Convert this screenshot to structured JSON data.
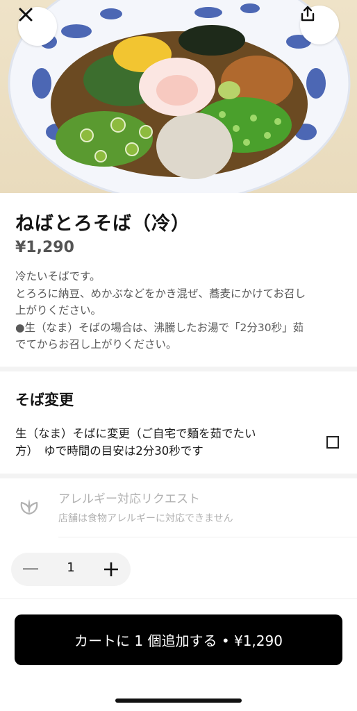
{
  "header": {
    "close_icon": "close-icon",
    "share_icon": "share-icon"
  },
  "product": {
    "name": "ねばとろそば（冷）",
    "price": "¥1,290",
    "description_lines": [
      "冷たいそばです。",
      "とろろに納豆、めかぶなどをかき混ぜ、蕎麦にかけてお召し",
      "上がりください。",
      "●生（なま）そばの場合は、沸騰したお湯で「2分30秒」茹",
      "でてからお召し上がりください。"
    ]
  },
  "options": {
    "section_title": "そば変更",
    "items": [
      {
        "line1": "生（なま）そばに変更（ご自宅で麺を茹でたい",
        "line2": "方）　ゆで時間の目安は2分30秒です",
        "checked": false
      }
    ]
  },
  "allergy": {
    "title": "アレルギー対応リクエスト",
    "subtitle": "店舗は食物アレルギーに対応できません",
    "icon": "leaf-icon"
  },
  "quantity": {
    "value": "1",
    "minus_label": "−",
    "plus_label": "+"
  },
  "cart": {
    "label": "カートに 1 個追加する • ¥1,290"
  },
  "colors": {
    "primary_button": "#000000",
    "muted_text": "#b2b2b2"
  }
}
